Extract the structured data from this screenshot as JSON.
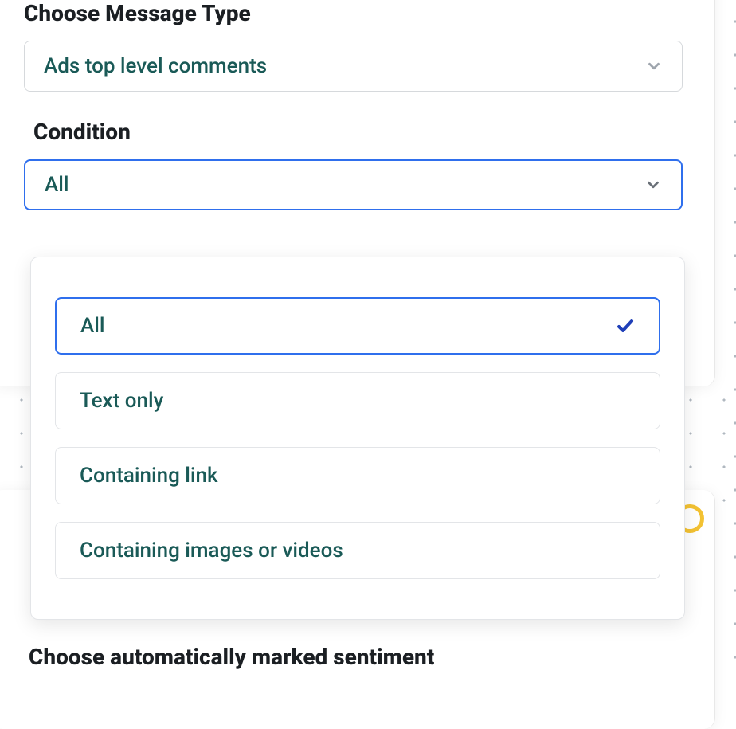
{
  "messageType": {
    "label": "Choose Message Type",
    "selected": "Ads top level comments"
  },
  "condition": {
    "label": "Condition",
    "selected": "All",
    "options": [
      {
        "label": "All",
        "selected": true
      },
      {
        "label": "Text only",
        "selected": false
      },
      {
        "label": "Containing link",
        "selected": false
      },
      {
        "label": "Containing images or videos",
        "selected": false
      }
    ]
  },
  "nextSection": {
    "partialHeading": "Choose automatically marked sentiment"
  }
}
